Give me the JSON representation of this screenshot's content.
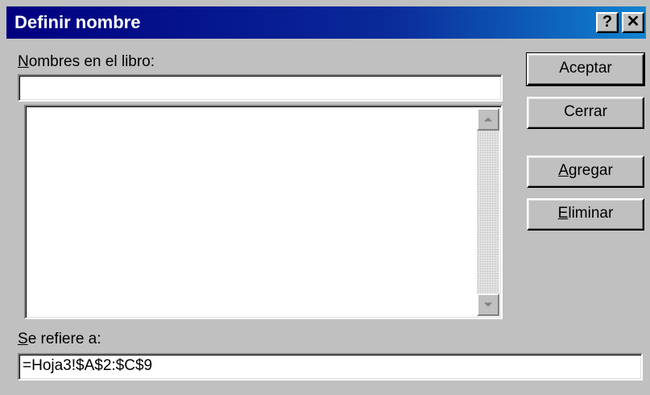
{
  "window": {
    "title": "Definir nombre",
    "help_glyph": "?",
    "close_glyph": "✕"
  },
  "names_section": {
    "label_mnemonic": "N",
    "label_rest": "ombres en el libro:",
    "input_value": "",
    "list_items": []
  },
  "refers_section": {
    "label_mnemonic": "S",
    "label_rest": "e refiere a:",
    "value": "=Hoja3!$A$2:$C$9"
  },
  "buttons": {
    "accept": "Aceptar",
    "close": "Cerrar",
    "add_mnemonic": "A",
    "add_rest": "gregar",
    "delete_mnemonic": "E",
    "delete_rest": "liminar"
  },
  "colors": {
    "titlebar_start": "#000080",
    "titlebar_end": "#1084d0",
    "dialog_face": "#c0c0c0"
  },
  "icons": {
    "help": "help-icon",
    "close": "close-icon",
    "scroll_up": "scroll-up-arrow-icon",
    "scroll_down": "scroll-down-arrow-icon"
  }
}
